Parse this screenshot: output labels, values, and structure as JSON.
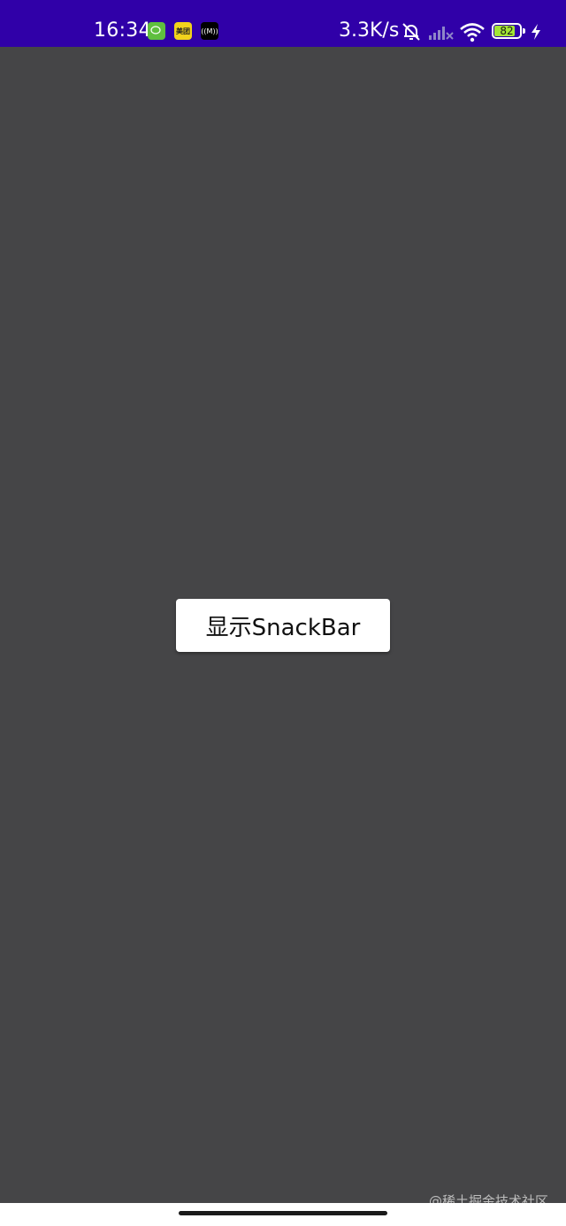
{
  "status_bar": {
    "time": "16:34",
    "net_speed": "3.3K/s",
    "battery_level": 82,
    "battery_label": "82",
    "background_color": "#3000a8",
    "app_icons": [
      {
        "name": "wechat-icon",
        "label": ""
      },
      {
        "name": "meituan-icon",
        "label": "美团"
      },
      {
        "name": "music-icon",
        "label": "((M))"
      }
    ],
    "icons": [
      "mute-bell-icon",
      "cell-signal-icon",
      "wifi-icon",
      "battery-icon",
      "charging-icon"
    ]
  },
  "main": {
    "background_color": "#454547",
    "button_label": "显示SnackBar"
  },
  "watermark": "@稀土掘金技术社区"
}
